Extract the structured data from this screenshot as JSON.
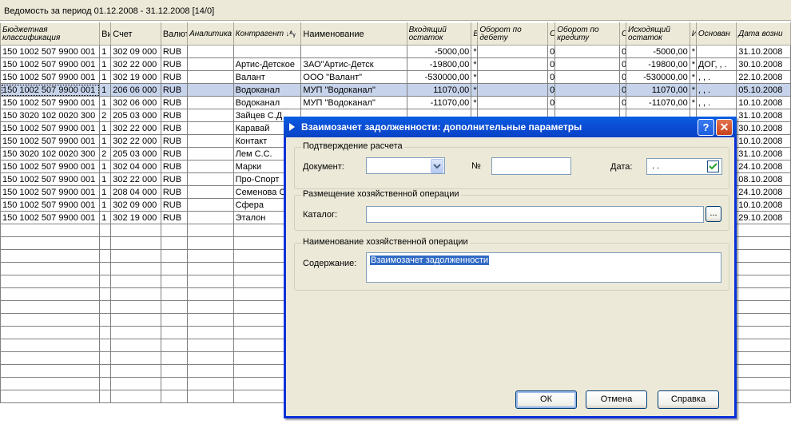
{
  "window": {
    "title": "Ведомость за период 01.12.2008 - 31.12.2008 [14/0]"
  },
  "grid": {
    "columns": [
      "Бюджетная классификация",
      "Ви",
      "Счет",
      "Валют",
      "Аналитика",
      "Контрагент",
      "Наименование",
      "Входящий остаток",
      "В",
      "Оборот по дебету",
      "Об",
      "Оборот по кредиту",
      "О",
      "Исходящий остаток",
      "И",
      "Основан",
      "Дата возни"
    ],
    "rows": [
      [
        "150 1002 507 9900 001",
        "1",
        "302 09 000",
        "RUB",
        "",
        "",
        "",
        "-5000,00",
        "*",
        "",
        "0",
        "",
        "0",
        "-5000,00",
        "*",
        "",
        "31.10.2008"
      ],
      [
        "150 1002 507 9900 001",
        "1",
        "302 22 000",
        "RUB",
        "",
        "Артис-Детское",
        "ЗАО\"Артис-Детск",
        "-19800,00",
        "*",
        "",
        "0",
        "",
        "0",
        "-19800,00",
        "*",
        "ДОГ, , .",
        "30.10.2008"
      ],
      [
        "150 1002 507 9900 001",
        "1",
        "302 19 000",
        "RUB",
        "",
        "Валант",
        "ООО \"Валант\"",
        "-530000,00",
        "*",
        "",
        "0",
        "",
        "0",
        "-530000,00",
        "*",
        ", , .",
        "22.10.2008"
      ],
      [
        "150 1002 507 9900 001",
        "1",
        "206 06 000",
        "RUB",
        "",
        "Водоканал",
        "МУП \"Водоканал\"",
        "11070,00",
        "*",
        "",
        "0",
        "",
        "0",
        "11070,00",
        "*",
        ", , .",
        "05.10.2008"
      ],
      [
        "150 1002 507 9900 001",
        "1",
        "302 06 000",
        "RUB",
        "",
        "Водоканал",
        "МУП \"Водоканал\"",
        "-11070,00",
        "*",
        "",
        "0",
        "",
        "0",
        "-11070,00",
        "*",
        ", , .",
        "10.10.2008"
      ],
      [
        "150 3020 102 0020 300",
        "2",
        "205 03 000",
        "RUB",
        "",
        "Зайцев С.Д",
        "",
        "",
        "",
        "",
        "",
        "",
        "",
        "",
        "",
        "",
        "31.10.2008"
      ],
      [
        "150 1002 507 9900 001",
        "1",
        "302 22 000",
        "RUB",
        "",
        "Каравай",
        "",
        "",
        "",
        "",
        "",
        "",
        "",
        "",
        "",
        "",
        "30.10.2008"
      ],
      [
        "150 1002 507 9900 001",
        "1",
        "302 22 000",
        "RUB",
        "",
        "Контакт",
        "",
        "",
        "",
        "",
        "",
        "",
        "",
        "",
        "",
        "",
        "10.10.2008"
      ],
      [
        "150 3020 102 0020 300",
        "2",
        "205 03 000",
        "RUB",
        "",
        "Лем С.С.",
        "",
        "",
        "",
        "",
        "",
        "",
        "",
        "",
        "",
        "",
        "31.10.2008"
      ],
      [
        "150 1002 507 9900 001",
        "1",
        "302 04 000",
        "RUB",
        "",
        "Марки",
        "",
        "",
        "",
        "",
        "",
        "",
        "",
        "",
        "",
        "",
        "24.10.2008"
      ],
      [
        "150 1002 507 9900 001",
        "1",
        "302 22 000",
        "RUB",
        "",
        "Про-Спорт",
        "",
        "",
        "",
        "",
        "",
        "",
        "",
        "",
        "",
        "",
        "08.10.2008"
      ],
      [
        "150 1002 507 9900 001",
        "1",
        "208 04 000",
        "RUB",
        "",
        "Семенова О",
        "",
        "",
        "",
        "",
        "",
        "",
        "",
        "",
        "",
        "",
        "24.10.2008"
      ],
      [
        "150 1002 507 9900 001",
        "1",
        "302 09 000",
        "RUB",
        "",
        "Сфера",
        "",
        "",
        "",
        "",
        "",
        "",
        "",
        "",
        "",
        "",
        "10.10.2008"
      ],
      [
        "150 1002 507 9900 001",
        "1",
        "302 19 000",
        "RUB",
        "",
        "Эталон",
        "",
        "",
        "",
        "",
        "",
        "",
        "",
        "",
        "",
        "",
        "29.10.2008"
      ]
    ],
    "selected_row": 3
  },
  "dialog": {
    "title": "Взаимозачет задолженности: дополнительные параметры",
    "group1": "Подтверждение расчета",
    "document_label": "Документ:",
    "number_label": "№",
    "date_label": "Дата:",
    "date_value": ". .",
    "group2": "Размещение хозяйственной операции",
    "catalog_label": "Каталог:",
    "browse_label": "...",
    "group3": "Наименование хозяйственной операции",
    "content_label": "Содержание:",
    "content_value": "Взаимозачет задолженности",
    "ok": "ОК",
    "cancel": "Отмена",
    "help": "Справка"
  }
}
